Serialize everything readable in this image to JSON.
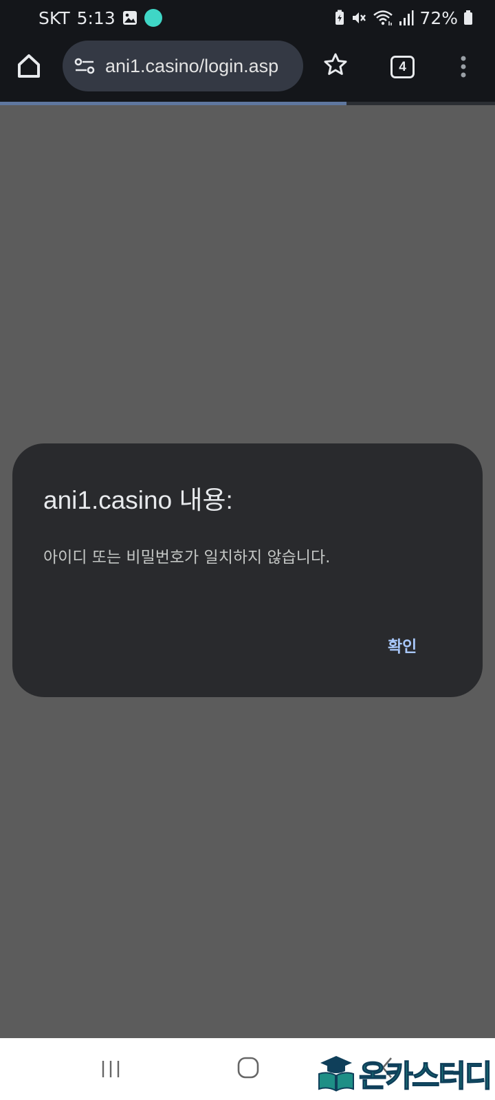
{
  "status_bar": {
    "carrier": "SKT",
    "time": "5:13",
    "battery_percent": "72%",
    "icons": [
      "gallery-icon",
      "app-icon",
      "battery-saver-icon",
      "mute-icon",
      "wifi-icon",
      "signal-icon",
      "battery-icon"
    ]
  },
  "toolbar": {
    "url": "ani1.casino/login.asp",
    "tab_count": "4",
    "page_load_progress": 0.7,
    "icons": [
      "home-icon",
      "site-settings-icon",
      "star-icon",
      "tabs-icon",
      "more-vert-icon"
    ]
  },
  "dialog": {
    "title": "ani1.casino 내용:",
    "message": "아이디 또는 비밀번호가 일치하지 않습니다.",
    "ok_label": "확인"
  },
  "nav_bar": {
    "icons": [
      "recent-apps-icon",
      "home-nav-icon",
      "back-icon"
    ]
  },
  "watermark": {
    "text": "온카스터디",
    "icon": "graduation-book-logo"
  },
  "colors": {
    "scrim": "#5c5c5c",
    "toolbar_bg": "#14161a",
    "url_bar_bg": "#343944",
    "dialog_bg": "#292a2d",
    "accent": "#a8c7fa",
    "watermark": "#1e8f86"
  }
}
